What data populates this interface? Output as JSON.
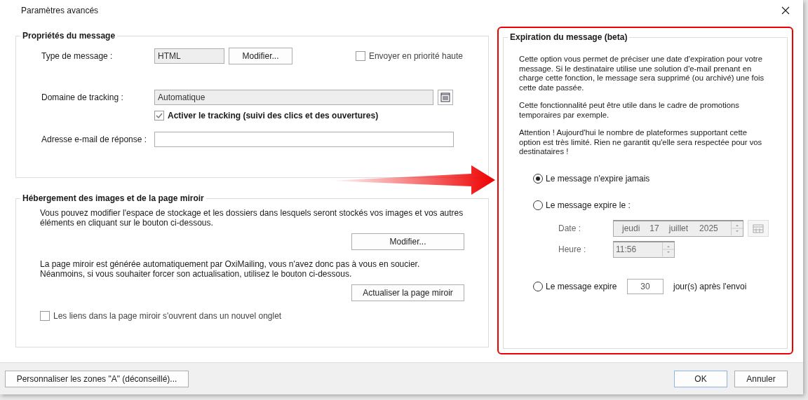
{
  "window": {
    "title": "Paramètres avancés"
  },
  "message_properties": {
    "title": "Propriétés du message",
    "message_type": {
      "label": "Type de message :",
      "value": "HTML",
      "button": "Modifier..."
    },
    "high_priority": {
      "label": "Envoyer en priorité haute",
      "checked": false
    },
    "tracking_domain": {
      "label": "Domaine de tracking :",
      "value": "Automatique"
    },
    "tracking": {
      "label": "Activer le tracking (suivi des clics et des ouvertures)",
      "checked": true
    },
    "reply_address": {
      "label": "Adresse e-mail de réponse :"
    }
  },
  "hosting": {
    "title": "Hébergement des images et de la page miroir",
    "storage_text": "Vous pouvez modifier l'espace de stockage et les dossiers dans lesquels seront stockés vos images et vos autres\néléments en cliquant sur le bouton ci-dessous.",
    "storage_button": "Modifier...",
    "mirror_text": "La page miroir est générée automatiquement par OxiMailing, vous n'avez donc pas à vous en soucier.\nNéanmoins, si vous souhaiter forcer son actualisation, utilisez le bouton ci-dessous.",
    "mirror_button": "Actualiser la page miroir",
    "new_tab": {
      "label": "Les liens dans la page miroir s'ouvrent dans un nouvel onglet",
      "checked": false
    }
  },
  "expiration": {
    "title": "Expiration du message (beta)",
    "paragraphs": [
      "Cette option vous permet de préciser une date d'expiration pour votre\nmessage. Si le destinataire utilise une solution d'e-mail prenant en\ncharge cette fonction, le message sera supprimé (ou archivé) une fois\ncette date passée.",
      "Cette fonctionnalité peut être utile dans le cadre de promotions\ntemporaires par exemple.",
      "Attention ! Aujourd'hui le nombre de plateformes supportant cette\noption est très limité. Rien ne garantit qu'elle sera respectée pour vos\ndestinataires !"
    ],
    "options": [
      {
        "kind": "never",
        "label": "Le message n'expire jamais",
        "selected": true
      },
      {
        "kind": "date",
        "label": "Le message expire le :",
        "selected": false,
        "date_label": "Date :",
        "weekday": "jeudi",
        "day": "17",
        "month": "juillet",
        "year": "2025",
        "time_label": "Heure :",
        "time": "11:56"
      },
      {
        "kind": "days",
        "label": "Le message expire",
        "selected": false,
        "value": "30",
        "suffix": "jour(s) après l'envoi"
      }
    ]
  },
  "footer": {
    "customize_button": "Personnaliser les zones \"A\" (déconseillé)...",
    "ok_button": {
      "label": "OK",
      "default": true
    },
    "cancel_button": "Annuler"
  }
}
